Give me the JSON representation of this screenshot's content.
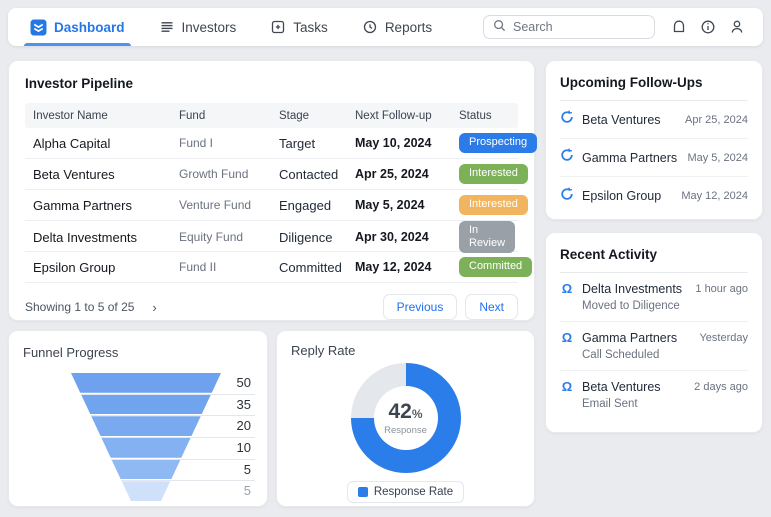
{
  "nav": {
    "tabs": [
      {
        "label": "Dashboard",
        "active": true
      },
      {
        "label": "Investors",
        "active": false
      },
      {
        "label": "Tasks",
        "active": false
      },
      {
        "label": "Reports",
        "active": false
      }
    ],
    "search_placeholder": "Search"
  },
  "accent": "#2b7de9",
  "icons": {
    "activity_glyph": "Ω"
  },
  "pipeline": {
    "title": "Investor Pipeline",
    "columns": [
      "Investor Name",
      "Fund",
      "Stage",
      "Next Follow-up",
      "Status"
    ],
    "rows": [
      {
        "name": "Alpha Capital",
        "fund": "Fund I",
        "stage": "Target",
        "next": "May 10, 2024",
        "status": "Prospecting",
        "status_color": "#2b7ce9"
      },
      {
        "name": "Beta Ventures",
        "fund": "Growth Fund",
        "stage": "Contacted",
        "next": "Apr 25, 2024",
        "status": "Interested",
        "status_color": "#7cb158"
      },
      {
        "name": "Gamma Partners",
        "fund": "Venture Fund",
        "stage": "Engaged",
        "next": "May 5, 2024",
        "status": "Interested",
        "status_color": "#f0b55e"
      },
      {
        "name": "Delta Investments",
        "fund": "Equity Fund",
        "stage": "Diligence",
        "next": "Apr 30, 2024",
        "status": "In Review",
        "status_color": "#9aa0a8"
      },
      {
        "name": "Epsilon Group",
        "fund": "Fund II",
        "stage": "Committed",
        "next": "May 12, 2024",
        "status": "Committed",
        "status_color": "#7cb158"
      }
    ],
    "footer": {
      "showing": "Showing 1 to 5 of 25",
      "chevron": "›",
      "previous": "Previous",
      "next": "Next"
    }
  },
  "followups": {
    "title": "Upcoming Follow-Ups",
    "items": [
      {
        "name": "Beta Ventures",
        "date": "Apr 25, 2024"
      },
      {
        "name": "Gamma Partners",
        "date": "May 5, 2024"
      },
      {
        "name": "Epsilon Group",
        "date": "May 12, 2024"
      }
    ]
  },
  "activity": {
    "title": "Recent Activity",
    "items": [
      {
        "name": "Delta Investments",
        "detail": "Moved to Diligence",
        "time": "1 hour ago"
      },
      {
        "name": "Gamma Partners",
        "detail": "Call Scheduled",
        "time": "Yesterday"
      },
      {
        "name": "Beta Ventures",
        "detail": "Email Sent",
        "time": "2 days ago"
      }
    ]
  },
  "chart_data": [
    {
      "type": "funnel",
      "title": "Funnel Progress",
      "values": [
        50,
        35,
        20,
        10,
        5,
        5
      ],
      "colors": [
        "#6ea2ee",
        "#70a4ee",
        "#79aaef",
        "#84b1f1",
        "#8fb9f3",
        "#cfe0fa"
      ],
      "orientation": "top-wide inverted funnel, value labels on right",
      "grid": true
    },
    {
      "type": "donut",
      "title": "Reply Rate",
      "value": 42,
      "unit": "%",
      "center_label": "Response",
      "legend": "Response Rate",
      "arc_percent": 75,
      "fill_color": "#2b7de9",
      "track_color": "#e4e7eb",
      "legend_position": "bottom-center"
    }
  ]
}
